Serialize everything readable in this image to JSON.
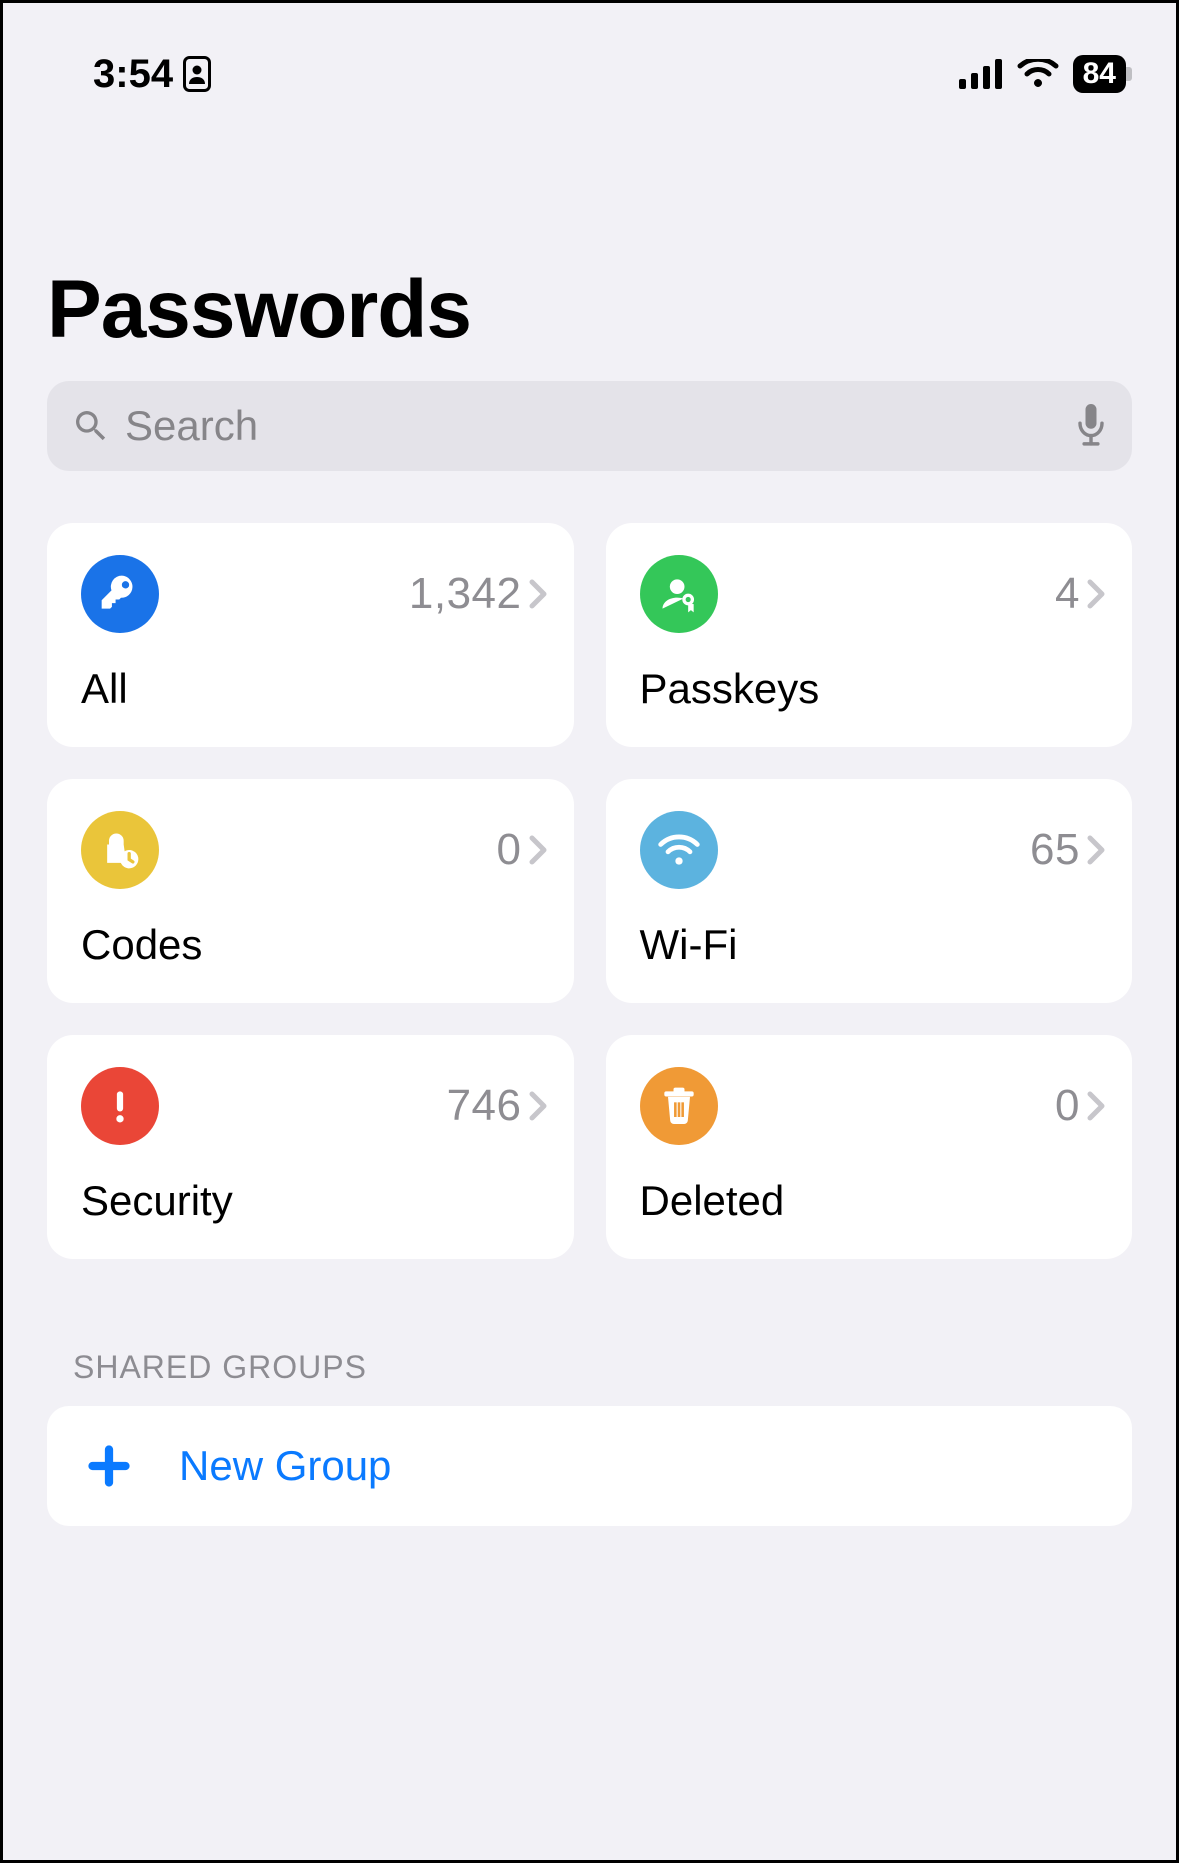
{
  "status": {
    "time": "3:54",
    "battery": "84"
  },
  "title": "Passwords",
  "search": {
    "placeholder": "Search"
  },
  "cards": {
    "all": {
      "label": "All",
      "count": "1,342"
    },
    "passkeys": {
      "label": "Passkeys",
      "count": "4"
    },
    "codes": {
      "label": "Codes",
      "count": "0"
    },
    "wifi": {
      "label": "Wi-Fi",
      "count": "65"
    },
    "security": {
      "label": "Security",
      "count": "746"
    },
    "deleted": {
      "label": "Deleted",
      "count": "0"
    }
  },
  "shared": {
    "header": "SHARED GROUPS",
    "new_group_label": "New Group"
  }
}
